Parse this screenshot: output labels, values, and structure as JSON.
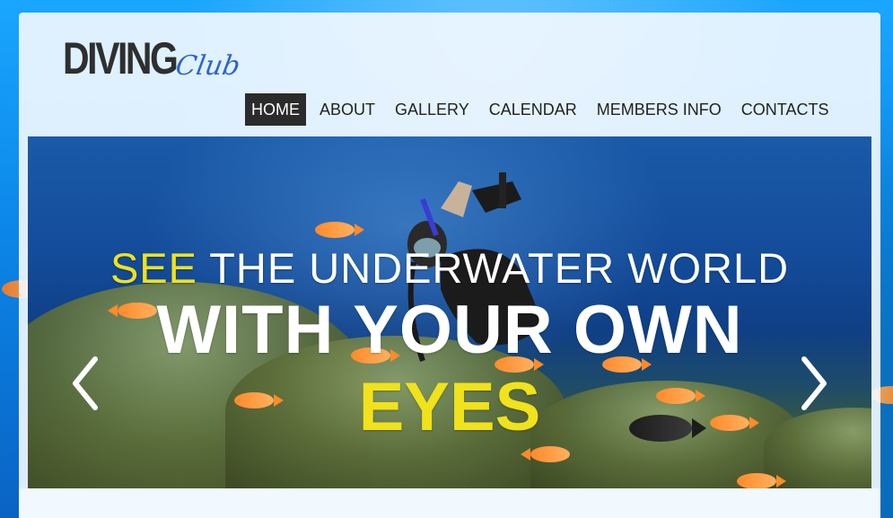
{
  "brand": {
    "logo_main": "DIVING",
    "logo_script": "Club"
  },
  "nav": {
    "items": [
      {
        "label": "HOME",
        "active": true
      },
      {
        "label": "ABOUT",
        "active": false
      },
      {
        "label": "GALLERY",
        "active": false
      },
      {
        "label": "CALENDAR",
        "active": false
      },
      {
        "label": "MEMBERS INFO",
        "active": false
      },
      {
        "label": "CONTACTS",
        "active": false
      }
    ]
  },
  "slider": {
    "line1_highlight": "SEE",
    "line1_rest": "THE UNDERWATER WORLD",
    "line2": "WITH YOUR OWN",
    "line3": "EYES",
    "prev_icon": "chevron-left-icon",
    "next_icon": "chevron-right-icon"
  },
  "colors": {
    "accent_yellow": "#f0e21b",
    "nav_active_bg": "#2b2b2b",
    "logo_script": "#2d64c8"
  }
}
